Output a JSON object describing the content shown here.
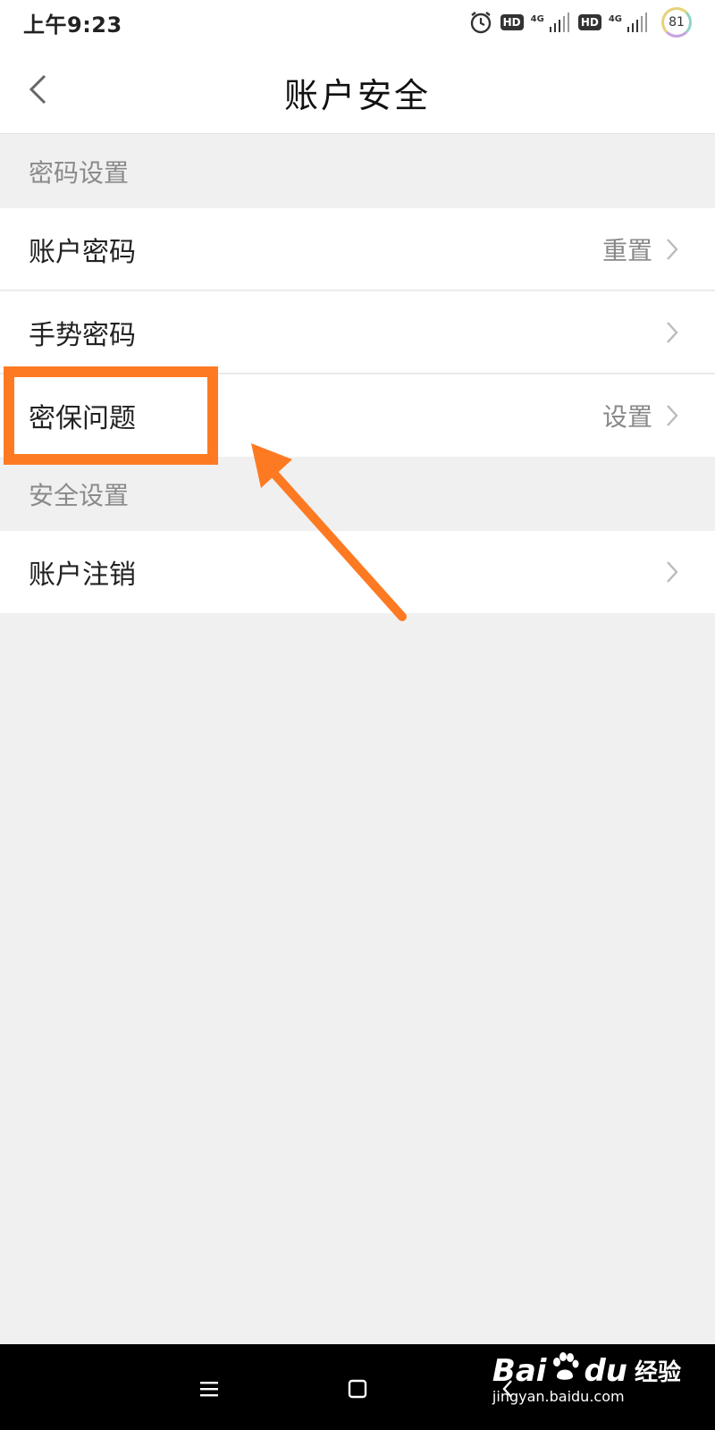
{
  "status_bar": {
    "time": "上午9:23",
    "hd_1": "HD",
    "net_1": "4G",
    "hd_2": "HD",
    "net_2": "4G",
    "battery": "81"
  },
  "header": {
    "title": "账户安全",
    "back_icon": "chevron-left-icon"
  },
  "sections": [
    {
      "header": "密码设置",
      "rows": [
        {
          "label": "账户密码",
          "value": "重置"
        },
        {
          "label": "手势密码",
          "value": ""
        },
        {
          "label": "密保问题",
          "value": "设置"
        }
      ]
    },
    {
      "header": "安全设置",
      "rows": [
        {
          "label": "账户注销",
          "value": ""
        }
      ]
    }
  ],
  "annotation": {
    "color": "#fd7a22",
    "target": "密保问题"
  },
  "system_nav": {
    "menu_icon": "menu-icon",
    "home_icon": "home-square-icon",
    "back_icon": "back-chevron-icon"
  },
  "watermark": {
    "brand": "Bai",
    "brand_suffix": "du",
    "cn": "经验",
    "url": "jingyan.baidu.com"
  }
}
